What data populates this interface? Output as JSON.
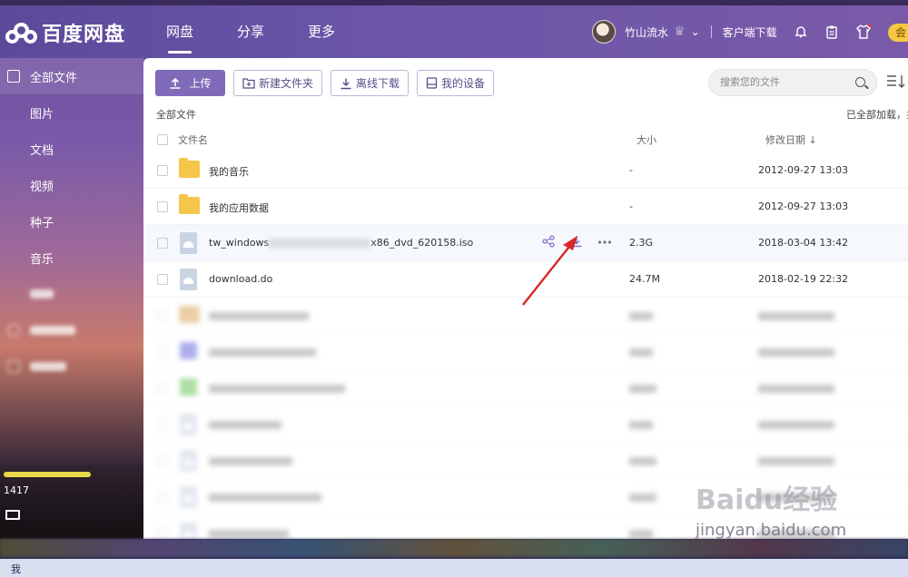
{
  "app": {
    "logo_text": "百度网盘"
  },
  "nav": [
    {
      "label": "网盘"
    },
    {
      "label": "分享"
    },
    {
      "label": "更多"
    }
  ],
  "user": {
    "name": "竹山流水",
    "client_download": "客户端下载",
    "vip_badge": "会"
  },
  "sidebar": {
    "all_files": "全部文件",
    "items": [
      {
        "label": "图片"
      },
      {
        "label": "文档"
      },
      {
        "label": "视频"
      },
      {
        "label": "种子"
      },
      {
        "label": "音乐"
      }
    ],
    "quota_text": "1417"
  },
  "toolbar": {
    "upload": "上传",
    "new_folder": "新建文件夹",
    "offline_download": "离线下载",
    "my_devices": "我的设备"
  },
  "search": {
    "placeholder": "搜索您的文件"
  },
  "breadcrumb": "全部文件",
  "loaded_status": "已全部加载，共",
  "columns": {
    "name": "文件名",
    "size": "大小",
    "date": "修改日期"
  },
  "files": [
    {
      "name": "我的音乐",
      "size": "-",
      "date": "2012-09-27 13:03",
      "type": "folder"
    },
    {
      "name": "我的应用数据",
      "size": "-",
      "date": "2012-09-27 13:03",
      "type": "folder"
    },
    {
      "name_prefix": "tw_windows",
      "name_suffix": "x86_dvd_620158.iso",
      "size": "2.3G",
      "date": "2018-03-04 13:42",
      "type": "file"
    },
    {
      "name": "download.do",
      "size": "24.7M",
      "date": "2018-02-19 22:32",
      "type": "file"
    }
  ],
  "taskbar": {
    "label": "我"
  },
  "watermark": {
    "logo": "Baidu经验",
    "url": "jingyan.baidu.com"
  },
  "colors": {
    "accent": "#7f6bb9",
    "folder": "#f6c64a",
    "arrow": "#d9262c"
  }
}
